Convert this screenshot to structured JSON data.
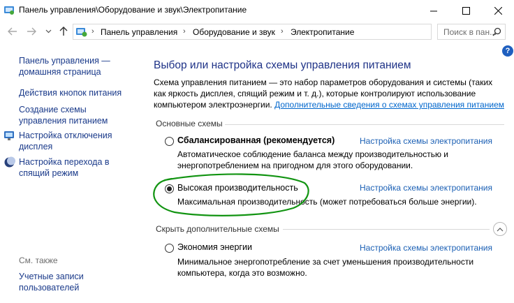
{
  "window": {
    "title": "Панель управления\\Оборудование и звук\\Электропитание"
  },
  "nav": {
    "breadcrumbs": [
      "Панель управления",
      "Оборудование и звук",
      "Электропитание"
    ],
    "search_placeholder": "Поиск в пан..."
  },
  "sidebar": {
    "home": "Панель управления — домашняя страница",
    "items": [
      "Действия кнопок питания",
      "Создание схемы управления питанием",
      "Настройка отключения дисплея",
      "Настройка перехода в спящий режим"
    ],
    "see_also_label": "См. также",
    "see_also_items": [
      "Учетные записи пользователей"
    ]
  },
  "main": {
    "heading": "Выбор или настройка схемы управления питанием",
    "description": "Схема управления питанием — это набор параметров оборудования и системы (таких как яркость дисплея, спящий режим и т. д.), которые контролируют использование компьютером электроэнергии.",
    "description_link": "Дополнительные сведения о схемах управления питанием",
    "group_main_label": "Основные схемы",
    "group_extra_label": "Скрыть дополнительные схемы",
    "plan_link_label": "Настройка схемы электропитания",
    "plans": [
      {
        "name": "Сбалансированная (рекомендуется)",
        "desc": "Автоматическое соблюдение баланса между производительностью и энергопотреблением на пригодном для этого оборудовании.",
        "selected": false
      },
      {
        "name": "Высокая производительность",
        "desc": "Максимальная производительность (может потребоваться больше энергии).",
        "selected": true
      },
      {
        "name": "Экономия энергии",
        "desc": "Минимальное энергопотребление за счет уменьшения производительности компьютера, когда это возможно.",
        "selected": false
      }
    ]
  },
  "colors": {
    "link": "#1a5fb4",
    "heading": "#1e3287",
    "annotation": "#129412"
  }
}
